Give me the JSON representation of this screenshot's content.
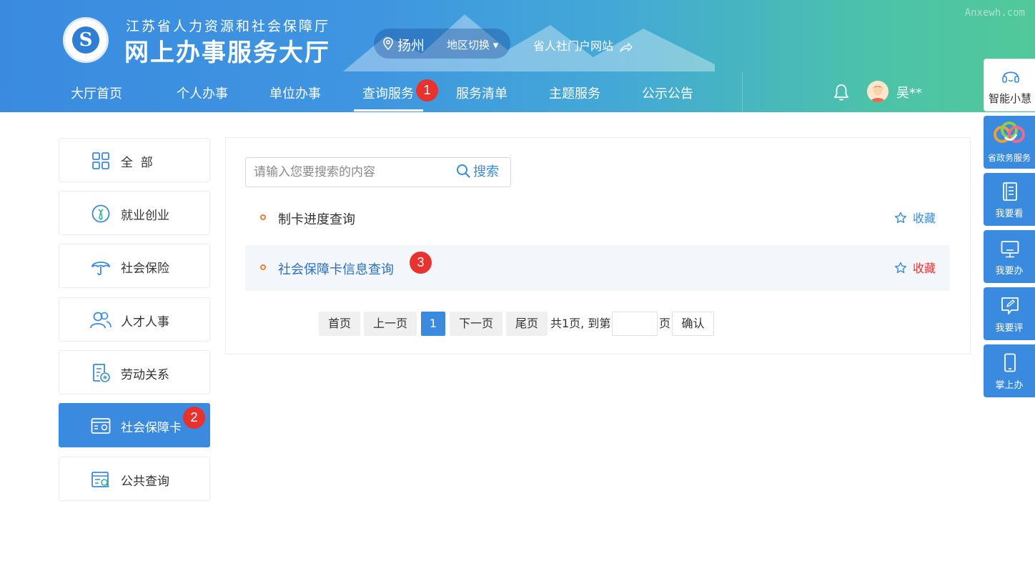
{
  "header": {
    "org_name": "江苏省人力资源和社会保障厅",
    "hall_name": "网上办事服务大厅",
    "city": "扬州",
    "region_switch": "地区切换 ▾",
    "portal_link": "省人社门户网站",
    "watermark": "Anxewh.com",
    "user_name": "吴**"
  },
  "nav": {
    "items": [
      "大厅首页",
      "个人办事",
      "单位办事",
      "查询服务",
      "服务清单",
      "主题服务",
      "公示公告"
    ],
    "active_index": 3
  },
  "badges": [
    "1",
    "2",
    "3"
  ],
  "sidebar": {
    "items": [
      {
        "label": "全  部",
        "icon": "grid-icon"
      },
      {
        "label": "就业创业",
        "icon": "employment-icon"
      },
      {
        "label": "社会保险",
        "icon": "umbrella-icon"
      },
      {
        "label": "人才人事",
        "icon": "people-icon"
      },
      {
        "label": "劳动关系",
        "icon": "document-star-icon"
      },
      {
        "label": "社会保障卡",
        "icon": "card-icon"
      },
      {
        "label": "公共查询",
        "icon": "search-list-icon"
      }
    ],
    "active_index": 5
  },
  "search": {
    "placeholder": "请输入您要搜索的内容",
    "button_label": "搜索"
  },
  "results": [
    {
      "title": "制卡进度查询",
      "fav_label": "收藏"
    },
    {
      "title": "社会保障卡信息查询",
      "fav_label": "收藏"
    }
  ],
  "pagination": {
    "first": "首页",
    "prev": "上一页",
    "current": "1",
    "next": "下一页",
    "last": "尾页",
    "total_text": "共1页, 到第",
    "page_unit": "页",
    "confirm": "确认"
  },
  "float_bar": {
    "items": [
      "智能小慧",
      "省政务服务",
      "我要看",
      "我要办",
      "我要评",
      "掌上办"
    ]
  },
  "colors": {
    "primary": "#3a8ae0",
    "badge": "#e8322e",
    "bullet": "#ee7e33",
    "header_start": "#3a8be0",
    "header_end": "#52c89a"
  }
}
